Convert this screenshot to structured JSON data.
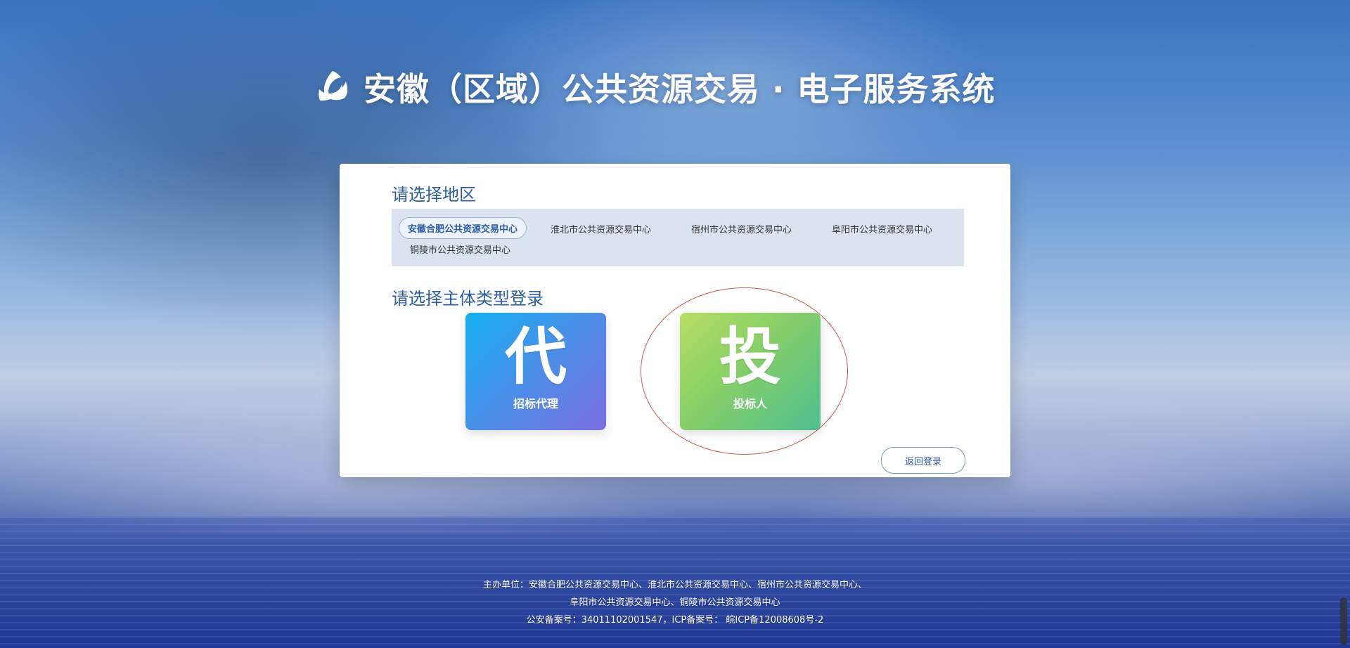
{
  "header": {
    "title": "安徽（区域）公共资源交易 · 电子服务系统",
    "logo_icon": "triangle-swirl-logo"
  },
  "region_section": {
    "title": "请选择地区",
    "regions": [
      {
        "label": "安徽合肥公共资源交易中心",
        "selected": true
      },
      {
        "label": "淮北市公共资源交易中心",
        "selected": false
      },
      {
        "label": "宿州市公共资源交易中心",
        "selected": false
      },
      {
        "label": "阜阳市公共资源交易中心",
        "selected": false
      },
      {
        "label": "铜陵市公共资源交易中心",
        "selected": false
      }
    ]
  },
  "login_section": {
    "title": "请选择主体类型登录",
    "tiles": [
      {
        "glyph": "代",
        "label": "招标代理"
      },
      {
        "glyph": "投",
        "label": "投标人"
      }
    ]
  },
  "actions": {
    "back_label": "返回登录"
  },
  "footer": {
    "line1": "主办单位：安徽合肥公共资源交易中心、淮北市公共资源交易中心、宿州市公共资源交易中心、",
    "line2": "阜阳市公共资源交易中心、铜陵市公共资源交易中心",
    "line3": "公安备案号：34011102001547，ICP备案号： 皖ICP备12008608号-2"
  },
  "colors": {
    "accent": "#2d5ea6",
    "selection_ring": "#d55555"
  }
}
